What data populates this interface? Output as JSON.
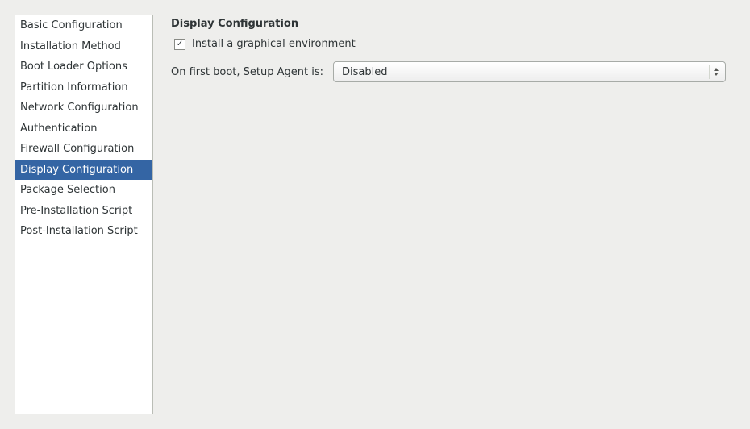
{
  "sidebar": {
    "items": [
      {
        "label": "Basic Configuration",
        "selected": false
      },
      {
        "label": "Installation Method",
        "selected": false
      },
      {
        "label": "Boot Loader Options",
        "selected": false
      },
      {
        "label": "Partition Information",
        "selected": false
      },
      {
        "label": "Network Configuration",
        "selected": false
      },
      {
        "label": "Authentication",
        "selected": false
      },
      {
        "label": "Firewall Configuration",
        "selected": false
      },
      {
        "label": "Display Configuration",
        "selected": true
      },
      {
        "label": "Package Selection",
        "selected": false
      },
      {
        "label": "Pre-Installation Script",
        "selected": false
      },
      {
        "label": "Post-Installation Script",
        "selected": false
      }
    ]
  },
  "main": {
    "title": "Display Configuration",
    "install_graphical": {
      "checked": true,
      "label": "Install a graphical environment"
    },
    "setup_agent": {
      "label": "On first boot, Setup Agent is:",
      "value": "Disabled"
    }
  }
}
